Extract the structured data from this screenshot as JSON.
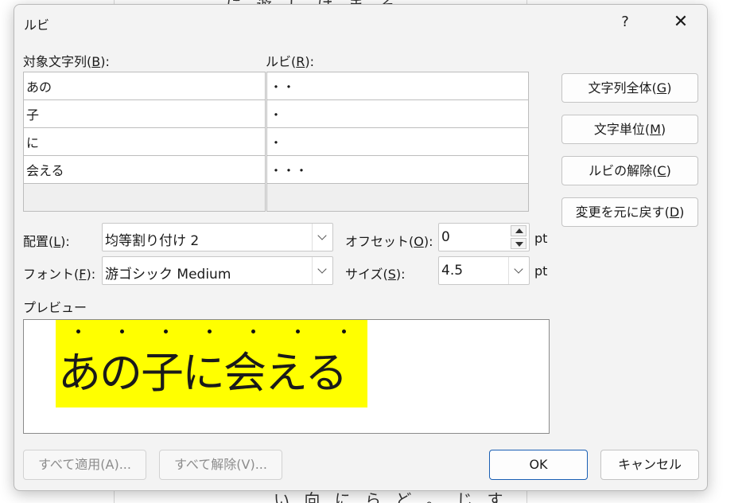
{
  "dialog": {
    "title": "ルビ",
    "help": "?",
    "close": "✕"
  },
  "labels": {
    "base_pre": "対象文字列(",
    "base_key": "B",
    "base_post": "):",
    "ruby_pre": "ルビ(",
    "ruby_key": "R",
    "ruby_post": "):",
    "align_pre": "配置(",
    "align_key": "L",
    "align_post": "):",
    "font_pre": "フォント(",
    "font_key": "F",
    "font_post": "):",
    "offset_pre": "オフセット(",
    "offset_key": "O",
    "offset_post": "):",
    "size_pre": "サイズ(",
    "size_key": "S",
    "size_post": "):",
    "pt1": "pt",
    "pt2": "pt",
    "preview": "プレビュー"
  },
  "rows": [
    {
      "base": "あの",
      "ruby": "・・"
    },
    {
      "base": "子",
      "ruby": "・"
    },
    {
      "base": "に",
      "ruby": "・"
    },
    {
      "base": "会える",
      "ruby": "・・・"
    },
    {
      "base": "",
      "ruby": ""
    }
  ],
  "buttons": {
    "whole_pre": "文字列全体(",
    "whole_key": "G",
    "whole_post": ")",
    "unit_pre": "文字単位(",
    "unit_key": "M",
    "unit_post": ")",
    "remove_pre": "ルビの解除(",
    "remove_key": "C",
    "remove_post": ")",
    "reset_pre": "変更を元に戻す(",
    "reset_key": "D",
    "reset_post": ")",
    "apply_all": "すべて適用(A)...",
    "remove_all": "すべて解除(V)...",
    "ok": "OK",
    "cancel": "キャンセル"
  },
  "fields": {
    "alignment": "均等割り付け 2",
    "font": "游ゴシック Medium",
    "offset": "0",
    "size": "4.5"
  },
  "preview": {
    "text": "あの子に会える",
    "highlight_color": "#ffff00"
  },
  "background_doc": {
    "top_fragment": "に 遊 し ば ま そ",
    "bottom_fragment": "い 向 に ら ど 。 じ す"
  },
  "icons": {
    "close": "close-icon",
    "dropdown": "chevron-down-icon",
    "spin_up": "spin-up-icon",
    "spin_down": "spin-down-icon"
  }
}
